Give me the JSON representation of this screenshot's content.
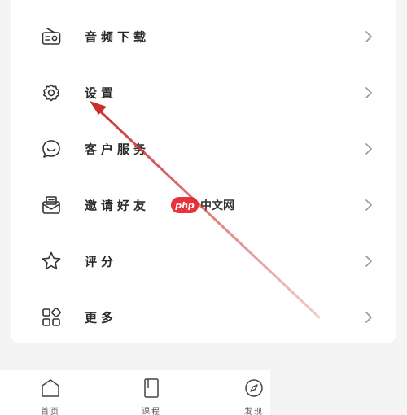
{
  "menu": {
    "items": [
      {
        "label": "音频下载",
        "icon": "radio-icon"
      },
      {
        "label": "设置",
        "icon": "gear-icon"
      },
      {
        "label": "客户服务",
        "icon": "chat-bubble-icon"
      },
      {
        "label": "邀请好友",
        "icon": "envelope-icon"
      },
      {
        "label": "评分",
        "icon": "star-icon"
      },
      {
        "label": "更多",
        "icon": "grid-icon"
      }
    ]
  },
  "tabbar": {
    "tabs": [
      {
        "label": "首页",
        "icon": "home-icon"
      },
      {
        "label": "课程",
        "icon": "book-icon"
      },
      {
        "label": "发现",
        "icon": "compass-icon"
      }
    ]
  },
  "watermark": {
    "badge": "php",
    "text": "中文网"
  },
  "colors": {
    "arrow": "#c9302c",
    "watermark_badge": "#e8323c",
    "icon_stroke": "#333333",
    "chevron": "#9a9a9a"
  }
}
